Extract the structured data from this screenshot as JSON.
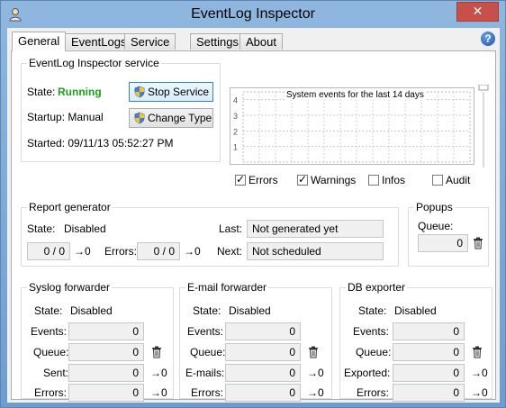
{
  "window": {
    "title": "EventLog Inspector",
    "close_label": "✕"
  },
  "tabs": [
    "General",
    "EventLogs",
    "Service Log",
    "Settings",
    "About"
  ],
  "help_label": "?",
  "service": {
    "group_title": "EventLog Inspector service",
    "state_label": "State:",
    "state_value": "Running",
    "startup_label": "Startup: Manual",
    "started_label": "Started: 09/11/13 05:52:27 PM",
    "stop_button": "Stop Service",
    "change_type_button": "Change Type"
  },
  "chart_data": {
    "type": "line",
    "title": "System events for the last 14 days",
    "y_ticks": [
      "4",
      "3",
      "2",
      "1"
    ],
    "ylim": [
      0,
      4.5
    ],
    "x_divisions": 14,
    "series": [],
    "grid": true
  },
  "chart_filters": [
    {
      "label": "Errors",
      "checked": true
    },
    {
      "label": "Warnings",
      "checked": true
    },
    {
      "label": "Infos",
      "checked": false
    },
    {
      "label": "Audit",
      "checked": false
    }
  ],
  "report": {
    "group_title": "Report generator",
    "state_label": "State:",
    "state_value": "Disabled",
    "count_value": "0 / 0",
    "errors_label": "Errors:",
    "errors_value": "0 / 0",
    "last_label": "Last:",
    "last_value": "Not generated yet",
    "next_label": "Next:",
    "next_value": "Not scheduled"
  },
  "popups": {
    "group_title": "Popups",
    "queue_label": "Queue:",
    "queue_value": "0"
  },
  "syslog": {
    "group_title": "Syslog forwarder",
    "state_label": "State:",
    "state_value": "Disabled",
    "events_label": "Events:",
    "events_value": "0",
    "queue_label": "Queue:",
    "queue_value": "0",
    "sent_label": "Sent:",
    "sent_value": "0",
    "errors_label": "Errors:",
    "errors_value": "0"
  },
  "email": {
    "group_title": "E-mail forwarder",
    "state_label": "State:",
    "state_value": "Disabled",
    "events_label": "Events:",
    "events_value": "0",
    "queue_label": "Queue:",
    "queue_value": "0",
    "emails_label": "E-mails:",
    "emails_value": "0",
    "errors_label": "Errors:",
    "errors_value": "0"
  },
  "db": {
    "group_title": "DB exporter",
    "state_label": "State:",
    "state_value": "Disabled",
    "events_label": "Events:",
    "events_value": "0",
    "queue_label": "Queue:",
    "queue_value": "0",
    "exported_label": "Exported:",
    "exported_value": "0",
    "errors_label": "Errors:",
    "errors_value": "0"
  },
  "reset_symbol": "→0",
  "icons": {
    "trash": "trash-icon",
    "reset": "reset-counter-icon",
    "shield": "uac-shield-icon",
    "app": "user-icon"
  }
}
